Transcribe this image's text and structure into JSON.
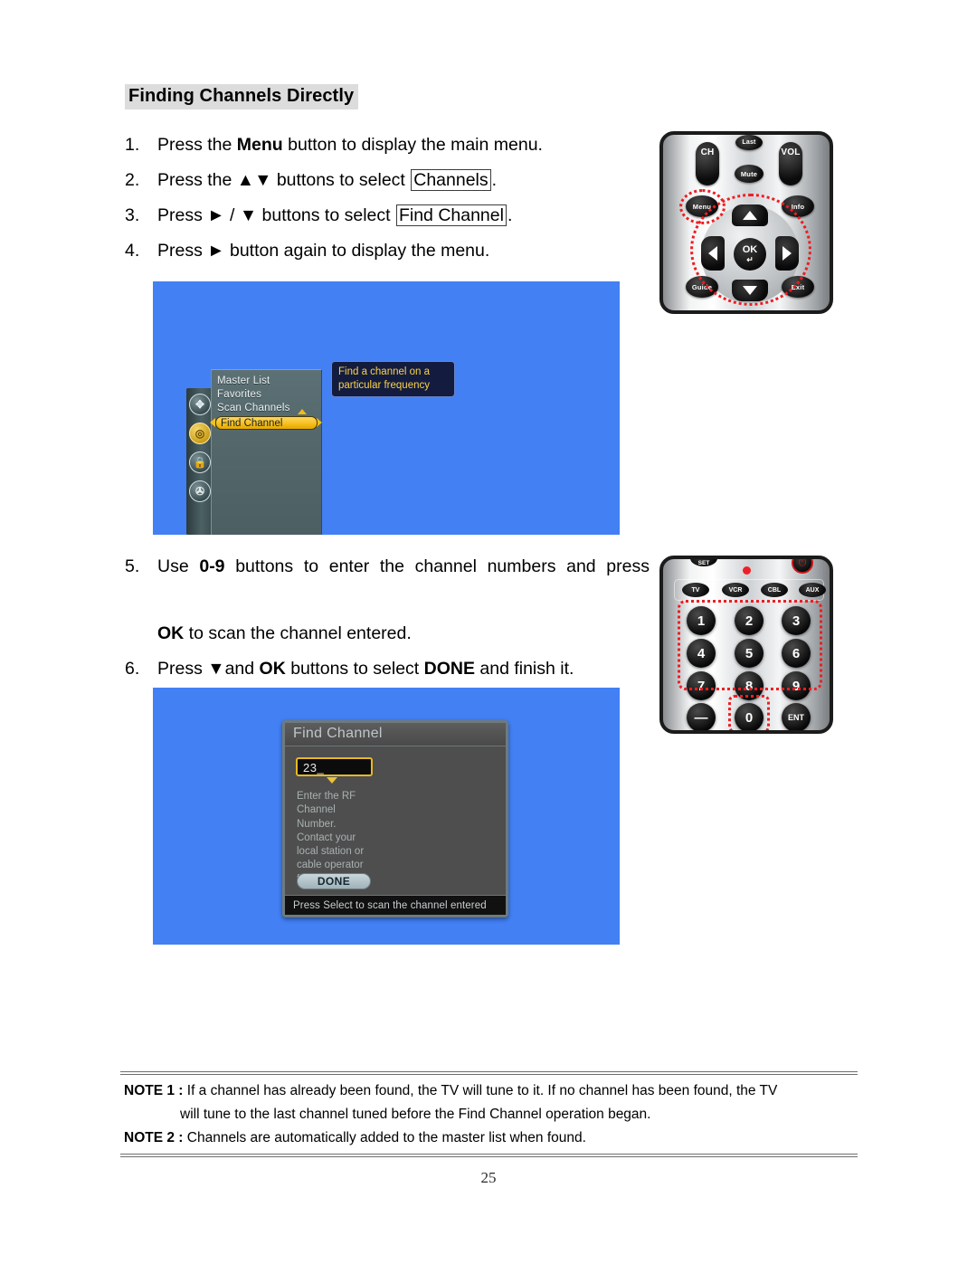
{
  "page": {
    "heading": "Finding Channels Directly",
    "page_number": "25"
  },
  "steps_top": [
    {
      "num": "1.",
      "parts": [
        {
          "t": "Press the ",
          "style": "normal"
        },
        {
          "t": "Menu",
          "style": "bold"
        },
        {
          "t": " button to display the main menu.",
          "style": "normal"
        }
      ]
    },
    {
      "num": "2.",
      "parts": [
        {
          "t": "Press the ",
          "style": "normal"
        },
        {
          "t": "▲▼",
          "style": "normal"
        },
        {
          "t": " buttons to select ",
          "style": "normal"
        },
        {
          "t": "Channels",
          "style": "boxed"
        },
        {
          "t": ".",
          "style": "normal"
        }
      ]
    },
    {
      "num": "3.",
      "parts": [
        {
          "t": "Press ",
          "style": "normal"
        },
        {
          "t": "► / ▼",
          "style": "normal"
        },
        {
          "t": " buttons to select ",
          "style": "normal"
        },
        {
          "t": "Find Channel",
          "style": "boxed"
        },
        {
          "t": ".",
          "style": "normal"
        }
      ]
    },
    {
      "num": "4.",
      "parts": [
        {
          "t": "Press ",
          "style": "normal"
        },
        {
          "t": "►",
          "style": "normal"
        },
        {
          "t": " button again to display the menu.",
          "style": "normal"
        }
      ]
    }
  ],
  "steps_bottom": [
    {
      "num": "5.",
      "line1": "Use 0-9 buttons to enter the channel numbers and press",
      "parts": [
        {
          "t": "Use ",
          "style": "normal"
        },
        {
          "t": "0-9",
          "style": "bold"
        },
        {
          "t": " buttons to enter the channel numbers and press",
          "style": "normal"
        }
      ],
      "parts2": [
        {
          "t": "OK",
          "style": "bold"
        },
        {
          "t": " to scan the channel entered.",
          "style": "normal"
        }
      ]
    },
    {
      "num": "6.",
      "parts": [
        {
          "t": "Press ",
          "style": "normal"
        },
        {
          "t": "▼",
          "style": "normal"
        },
        {
          "t": "and ",
          "style": "normal"
        },
        {
          "t": "OK",
          "style": "bold"
        },
        {
          "t": " buttons to select ",
          "style": "normal"
        },
        {
          "t": "DONE",
          "style": "bold"
        },
        {
          "t": " and finish it.",
          "style": "normal"
        }
      ]
    }
  ],
  "tv_screen_menu": {
    "rail_icons": [
      {
        "name": "setup-icon",
        "glyph": "✥",
        "active": false
      },
      {
        "name": "antenna-channels-icon",
        "glyph": "◎",
        "active": true
      },
      {
        "name": "lock-icon",
        "glyph": "■",
        "active": false
      },
      {
        "name": "av-icon",
        "glyph": "⚇",
        "active": false
      }
    ],
    "menu_items": [
      "Master List",
      "Favorites",
      "Scan Channels"
    ],
    "selected_item": "Find Channel",
    "tooltip_line1": "Find a channel on a",
    "tooltip_line2": "particular frequency"
  },
  "tv_screen_dialog": {
    "title": "Find Channel",
    "input_value": "23_",
    "help_text": "Enter the RF Channel Number. Contact your local station or cable operator for this inform...",
    "done_label": "DONE",
    "status_text": "Press Select to scan the channel entered"
  },
  "remote_nav": {
    "name": "navigation-remote",
    "buttons": {
      "ch": "CH",
      "vol": "VOL",
      "last": "Last",
      "mute": "Mute",
      "menu": "Menu",
      "info": "Info",
      "guide": "Guide",
      "exit": "Exit",
      "ok": "OK"
    }
  },
  "remote_keypad": {
    "name": "keypad-remote",
    "set_label": "SET",
    "modes": [
      "TV",
      "VCR",
      "CBL",
      "AUX"
    ],
    "keys": [
      "1",
      "2",
      "3",
      "4",
      "5",
      "6",
      "7",
      "8",
      "9"
    ],
    "dash_label": "—",
    "zero_label": "0",
    "ent_label": "ENT"
  },
  "notes": {
    "note1_label": "NOTE 1 :",
    "note1_line1": "If a channel has already been found, the TV will tune to it. If no channel has been found, the TV",
    "note1_line2": "will tune to the last channel tuned before the Find Channel operation began.",
    "note2_label": "NOTE 2 :",
    "note2_text": "Channels are automatically added to the master list when found."
  },
  "colors": {
    "tv_background": "#4280f4",
    "highlight_yellow": "#f5bd18",
    "heading_highlight": "#dcdcdc",
    "annotation_red": "#ee1d22"
  }
}
